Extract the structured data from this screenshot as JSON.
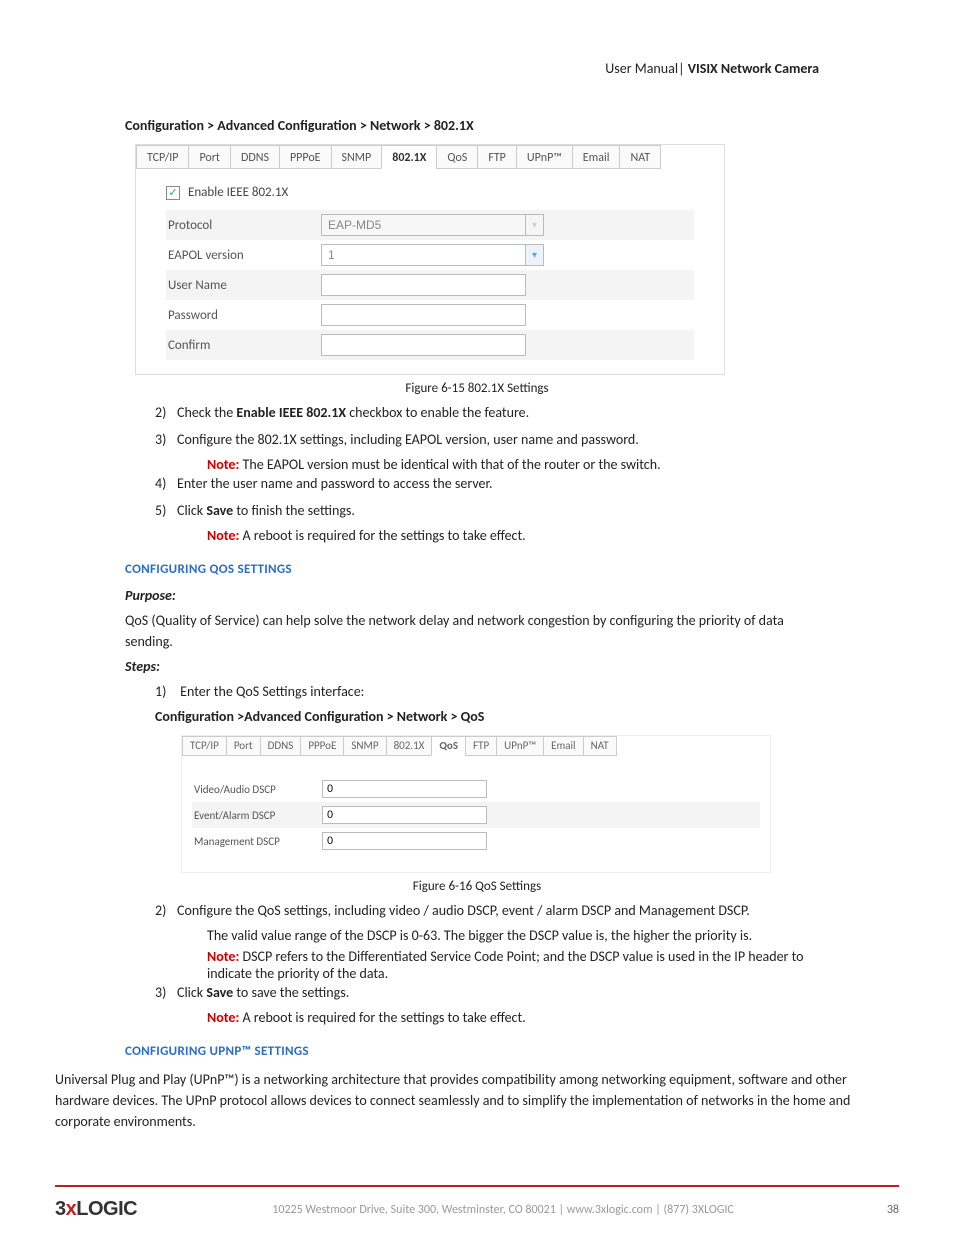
{
  "header": {
    "left": "User Manual",
    "right": "VISIX Network Camera"
  },
  "breadcrumb1": "Configuration > Advanced Configuration > Network > 802.1X",
  "fig1": {
    "tabs": [
      "TCP/IP",
      "Port",
      "DDNS",
      "PPPoE",
      "SNMP",
      "802.1X",
      "QoS",
      "FTP",
      "UPnP™",
      "Email",
      "NAT"
    ],
    "active_index": 5,
    "enable_label": "Enable IEEE 802.1X",
    "rows": [
      {
        "label": "Protocol",
        "value": "EAP-MD5",
        "dropdown": true,
        "disabled": true
      },
      {
        "label": "EAPOL version",
        "value": "1",
        "dropdown": true,
        "disabled": false
      },
      {
        "label": "User Name",
        "value": "",
        "dropdown": false
      },
      {
        "label": "Password",
        "value": "",
        "dropdown": false
      },
      {
        "label": "Confirm",
        "value": "",
        "dropdown": false
      }
    ],
    "caption_pre": "Figure 6-15 ",
    "caption": "802.1X Settings"
  },
  "steps1": [
    {
      "n": "2)",
      "pre": "Check the ",
      "bold": "Enable IEEE 802.1X",
      "post": " checkbox to enable the feature."
    },
    {
      "n": "3)",
      "text": "Configure the 802.1X settings, including EAPOL version, user name and password.",
      "note": "The EAPOL version must be identical with that of the router or the switch."
    },
    {
      "n": "4)",
      "text": "Enter the user name and password to access the server."
    },
    {
      "n": "5)",
      "pre": "Click ",
      "bold": "Save",
      "post": " to finish the settings.",
      "note": "A reboot is required for the settings to take effect."
    }
  ],
  "sect_qos": "CONFIGURING QOS SETTINGS",
  "purpose_lbl": "Purpose:",
  "qos_para": "QoS (Quality of Service) can help solve the network delay and network congestion by configuring the priority of data sending.",
  "steps_lbl": "Steps:",
  "step_qos_1": {
    "n": "1)",
    "text": "Enter the QoS Settings interface:"
  },
  "breadcrumb2": "Configuration >Advanced Configuration > Network > QoS",
  "fig2": {
    "tabs": [
      "TCP/IP",
      "Port",
      "DDNS",
      "PPPoE",
      "SNMP",
      "802.1X",
      "QoS",
      "FTP",
      "UPnP™",
      "Email",
      "NAT"
    ],
    "active_index": 6,
    "rows": [
      {
        "label": "Video/Audio DSCP",
        "value": "0"
      },
      {
        "label": "Event/Alarm DSCP",
        "value": "0"
      },
      {
        "label": "Management DSCP",
        "value": "0"
      }
    ],
    "caption_pre": "Figure 6-16 ",
    "caption": "QoS Settings"
  },
  "steps2": [
    {
      "n": "2)",
      "text": "Configure the QoS settings, including video / audio DSCP, event / alarm DSCP and Management DSCP.",
      "extra": "The valid value range of the DSCP is 0-63. The bigger the DSCP value is, the higher the priority is.",
      "note": "DSCP refers to the Differentiated Service Code Point; and the DSCP value is used in the IP header to indicate the priority of the data."
    },
    {
      "n": "3)",
      "pre": "Click ",
      "bold": "Save",
      "post": " to save the settings.",
      "note": "A reboot is required for the settings to take effect."
    }
  ],
  "sect_upnp": "CONFIGURING UPNP™ SETTINGS",
  "upnp_para": "Universal Plug and Play (UPnP™) is a networking architecture that provides compatibility among networking equipment, software and other hardware devices. The UPnP protocol allows devices to connect seamlessly and to simplify the implementation of networks in the home and corporate environments.",
  "note_label": "Note: ",
  "footer": {
    "logo_pre": "3",
    "logo_x": "x",
    "logo_post": "LOGIC",
    "addr": "10225 Westmoor Drive, Suite 300, Westminster, CO 80021  |  www.3xlogic.com  |  (877) 3XLOGIC",
    "page": "38"
  }
}
